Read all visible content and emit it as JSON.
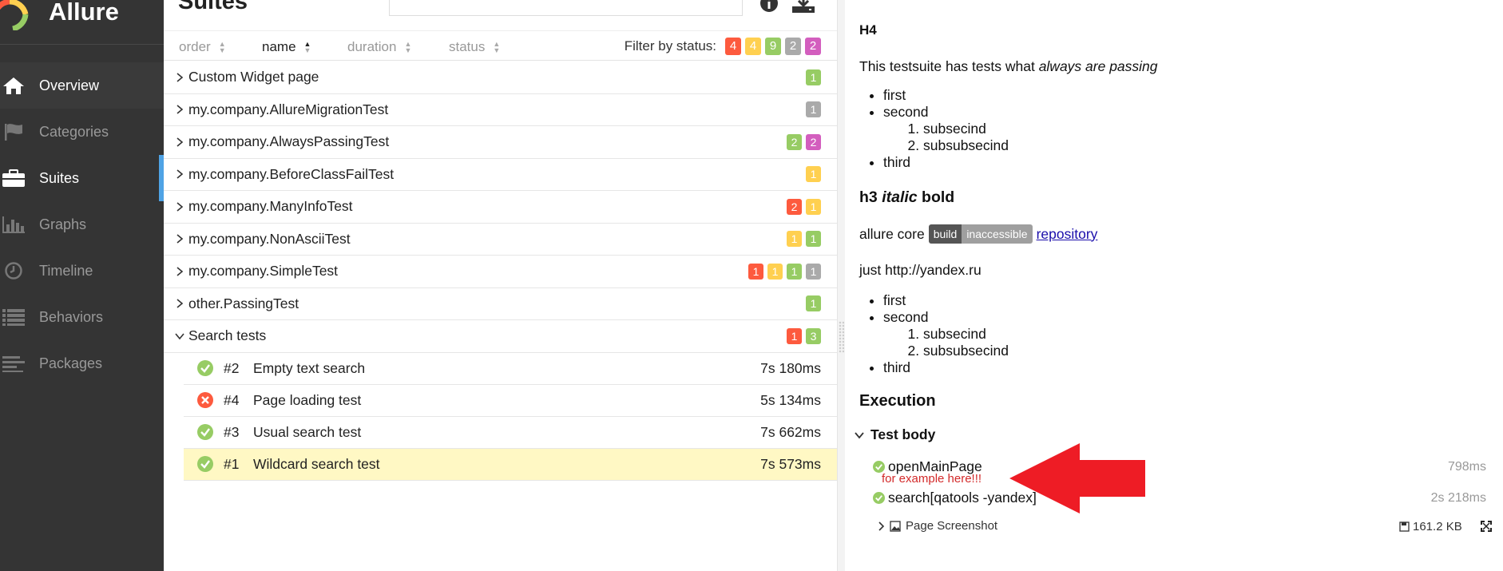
{
  "sidebar": {
    "brand": "Allure",
    "items": [
      {
        "label": "Overview"
      },
      {
        "label": "Categories"
      },
      {
        "label": "Suites"
      },
      {
        "label": "Graphs"
      },
      {
        "label": "Timeline"
      },
      {
        "label": "Behaviors"
      },
      {
        "label": "Packages"
      }
    ]
  },
  "main": {
    "title": "Suites",
    "sort": [
      "order",
      "name",
      "duration",
      "status"
    ],
    "filter_label": "Filter by status:",
    "filter_counts": [
      "4",
      "4",
      "9",
      "2",
      "2"
    ],
    "suites": [
      {
        "name": "Custom Widget page",
        "badges": [
          {
            "c": "green",
            "v": "1"
          }
        ]
      },
      {
        "name": "my.company.AllureMigrationTest",
        "badges": [
          {
            "c": "gray",
            "v": "1"
          }
        ]
      },
      {
        "name": "my.company.AlwaysPassingTest",
        "badges": [
          {
            "c": "green",
            "v": "2"
          },
          {
            "c": "purple",
            "v": "2"
          }
        ]
      },
      {
        "name": "my.company.BeforeClassFailTest",
        "badges": [
          {
            "c": "yellow",
            "v": "1"
          }
        ]
      },
      {
        "name": "my.company.ManyInfoTest",
        "badges": [
          {
            "c": "red",
            "v": "2"
          },
          {
            "c": "yellow",
            "v": "1"
          }
        ]
      },
      {
        "name": "my.company.NonAsciiTest",
        "badges": [
          {
            "c": "yellow",
            "v": "1"
          },
          {
            "c": "green",
            "v": "1"
          }
        ]
      },
      {
        "name": "my.company.SimpleTest",
        "badges": [
          {
            "c": "red",
            "v": "1"
          },
          {
            "c": "yellow",
            "v": "1"
          },
          {
            "c": "green",
            "v": "1"
          },
          {
            "c": "gray",
            "v": "1"
          }
        ]
      },
      {
        "name": "other.PassingTest",
        "badges": [
          {
            "c": "green",
            "v": "1"
          }
        ]
      },
      {
        "name": "Search tests",
        "badges": [
          {
            "c": "red",
            "v": "1"
          },
          {
            "c": "green",
            "v": "3"
          }
        ]
      }
    ],
    "tests": [
      {
        "num": "#2",
        "name": "Empty text search",
        "dur": "7s 180ms",
        "status": "passed"
      },
      {
        "num": "#4",
        "name": "Page loading test",
        "dur": "5s 134ms",
        "status": "failed"
      },
      {
        "num": "#3",
        "name": "Usual search test",
        "dur": "7s 662ms",
        "status": "passed"
      },
      {
        "num": "#1",
        "name": "Wildcard search test",
        "dur": "7s 573ms",
        "status": "passed"
      }
    ]
  },
  "detail": {
    "h4": "H4",
    "desc_start": "This testsuite has tests what ",
    "desc_em": "always are passing",
    "list1": {
      "first": "first",
      "second": "second",
      "sub1": "subsecind",
      "sub2": "subsubsecind",
      "third": "third"
    },
    "h3_a": "h3 ",
    "h3_em": "italic",
    "h3_b": " bold",
    "core_label": "allure core",
    "shield_a": "build",
    "shield_b": "inaccessible",
    "repo_link": "repository",
    "just": "just http://yandex.ru",
    "list2": {
      "first": "first",
      "second": "second",
      "sub1": "subsecind",
      "sub2": "subsubsecind",
      "third": "third"
    },
    "execution": "Execution",
    "test_body": "Test body",
    "step1": "openMainPage",
    "step1_dur": "798ms",
    "annotation": "for example here!!!",
    "step2": "search[qatools -yandex]",
    "step2_dur": "2s 218ms",
    "attachment": "Page Screenshot",
    "attachment_size": "161.2 KB"
  },
  "colors": {
    "sidebar": "#343434",
    "red": "#fd5a3e",
    "yellow": "#ffd050",
    "green": "#97cc64",
    "gray": "#aaaaaa",
    "purple": "#d35ebe",
    "selected": "#fff8c4",
    "accent": "#4fa3e5",
    "annotation": "#ee1c25"
  }
}
